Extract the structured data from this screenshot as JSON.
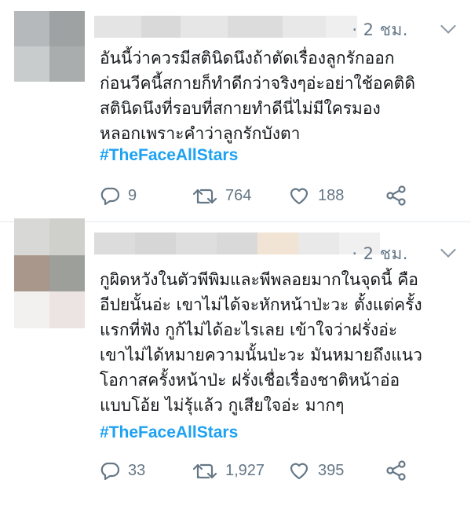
{
  "tweets": [
    {
      "meta": "· 2 ชม.",
      "text": "อันนี้ว่าควรมีสตินิดนึงถ้าตัดเรื่องลูกรักออก\nก่อนวีคนี้สกายก็ทำดีกว่าจริงๆอ่ะอย่าใช้อคติดิ\nสตินิดนึงที่รอบที่สกายทำดีนี่ไม่มีใครมอง\nหลอกเพราะคำว่าลูกรักบังตา",
      "hashtag": "#TheFaceAllStars",
      "replies": "9",
      "retweets": "764",
      "likes": "188"
    },
    {
      "meta": "· 2 ชม.",
      "text": "กูผิดหวังในตัวพีพิมและพีพลอยมากในจุดนี้ คือ\nอีปยนั้นอ่ะ เขาไม่ได้จะหักหน้าป่ะวะ ตั้งแต่ครั้ง\nแรกที่ฟัง กูก้ไม่ได้อะไรเลย เข้าใจว่าฝรั่งอ่ะ\nเขาไม่ได้หมายความนั้นป่ะวะ มันหมายถึงแนว\nโอกาสครั้งหน้าป่ะ ฝรั่งเชื่อเรื่องชาติหน้าอ่อ\nแบบโอ้ย ไม่รุ้แล้ว กูเสียใจอ่ะ มากๆ",
      "hashtag": "#TheFaceAllStars",
      "replies": "33",
      "retweets": "1,927",
      "likes": "395"
    }
  ],
  "colors": {
    "hashtag": "#1da1f2",
    "meta": "#657786",
    "icon": "#657786",
    "divider": "#e1e8ed"
  },
  "icons": [
    "reply-icon",
    "retweet-icon",
    "like-icon",
    "share-icon",
    "caret-down-icon"
  ]
}
